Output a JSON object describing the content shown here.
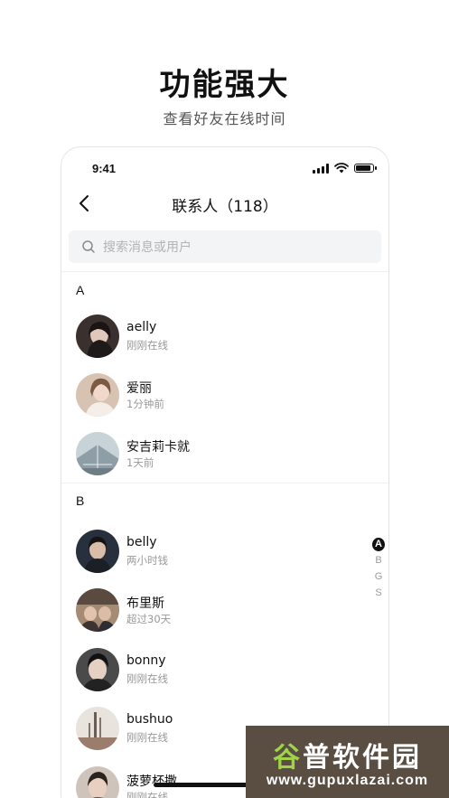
{
  "hero": {
    "title": "功能强大",
    "subtitle": "查看好友在线时间"
  },
  "status_bar": {
    "time": "9:41",
    "battery_level": 0.9
  },
  "nav": {
    "title": "联系人（118）"
  },
  "search": {
    "placeholder": "搜索消息或用户"
  },
  "sections": [
    {
      "letter": "A",
      "contacts": [
        {
          "name": "aelly",
          "status": "刚刚在线",
          "avatar_color": "#4a3f3d"
        },
        {
          "name": "爱丽",
          "status": "1分钟前",
          "avatar_color": "#c9a38d"
        },
        {
          "name": "安吉莉卡就",
          "status": "1天前",
          "avatar_color": "#9fb0b8"
        }
      ]
    },
    {
      "letter": "B",
      "contacts": [
        {
          "name": "belly",
          "status": "两小时钱",
          "avatar_color": "#2c3645"
        },
        {
          "name": "布里斯",
          "status": "超过30天",
          "avatar_color": "#8a6b58"
        },
        {
          "name": "bonny",
          "status": "刚刚在线",
          "avatar_color": "#3b3b3b"
        },
        {
          "name": "bushuo",
          "status": "刚刚在线",
          "avatar_color": "#b9a89b"
        },
        {
          "name": "菠萝杯撒",
          "status": "刚刚在线",
          "avatar_color": "#6d5a4e"
        }
      ]
    }
  ],
  "index_bar": [
    "A",
    "B",
    "G",
    "S"
  ],
  "index_active": "A",
  "watermark": {
    "top_accent": "谷",
    "top_rest": "普软件园",
    "url": "www.gupuxlazai.com"
  }
}
